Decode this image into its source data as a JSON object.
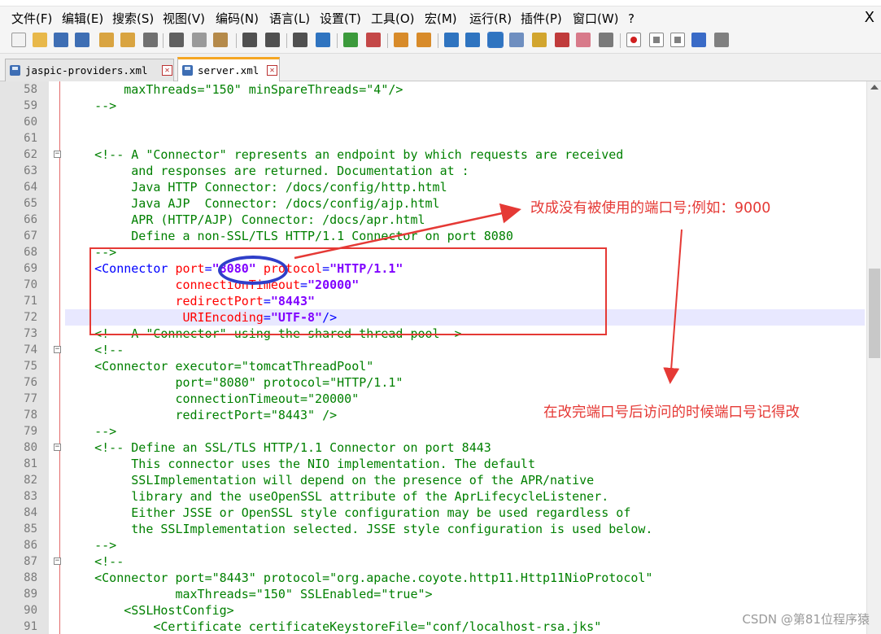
{
  "menu": {
    "items": [
      "文件(F)",
      "编辑(E)",
      "搜索(S)",
      "视图(V)",
      "编码(N)",
      "语言(L)",
      "设置(T)",
      "工具(O)",
      "宏(M)",
      "运行(R)",
      "插件(P)",
      "窗口(W)",
      "?"
    ],
    "close_label": "X"
  },
  "toolbar": {
    "buttons": [
      {
        "icon": "new-file-icon",
        "color": "#f2f2f2"
      },
      {
        "icon": "open-file-icon",
        "color": "#e8b84a"
      },
      {
        "icon": "save-icon",
        "color": "#3e6eb4"
      },
      {
        "icon": "save-all-icon",
        "color": "#3e6eb4"
      },
      {
        "icon": "close-icon",
        "color": "#d9a441"
      },
      {
        "icon": "close-all-icon",
        "color": "#d9a441"
      },
      {
        "icon": "print-icon",
        "color": "#707070"
      },
      {
        "icon": "cut-icon",
        "color": "#606060"
      },
      {
        "icon": "copy-icon",
        "color": "#9a9a9a"
      },
      {
        "icon": "paste-icon",
        "color": "#b58a4a"
      },
      {
        "icon": "undo-icon",
        "color": "#505050"
      },
      {
        "icon": "redo-icon",
        "color": "#505050"
      },
      {
        "icon": "find-icon",
        "color": "#505050"
      },
      {
        "icon": "replace-icon",
        "color": "#2f74c0"
      },
      {
        "icon": "zoom-in-icon",
        "color": "#3c9a3c"
      },
      {
        "icon": "zoom-out-icon",
        "color": "#c44848"
      },
      {
        "icon": "sync-vertical-icon",
        "color": "#d88b2a"
      },
      {
        "icon": "sync-horizontal-icon",
        "color": "#d88b2a"
      },
      {
        "icon": "word-wrap-icon",
        "color": "#2f74c0"
      },
      {
        "icon": "show-all-chars-icon",
        "color": "#2f74c0"
      },
      {
        "icon": "indent-guide-icon",
        "color": "#2f74c0"
      },
      {
        "icon": "user-language-icon",
        "color": "#6f8fc0"
      },
      {
        "icon": "document-map-icon",
        "color": "#d2a52e"
      },
      {
        "icon": "function-list-icon",
        "color": "#c03b3b"
      },
      {
        "icon": "folder-workspace-icon",
        "color": "#d87a8a"
      },
      {
        "icon": "monitoring-icon",
        "color": "#7a7a7a"
      },
      {
        "icon": "record-macro-icon",
        "color": "#d02020"
      },
      {
        "icon": "stop-macro-icon",
        "color": "#808080"
      },
      {
        "icon": "play-macro-icon",
        "color": "#808080"
      },
      {
        "icon": "run-macro-multiple-icon",
        "color": "#3a6bc7"
      },
      {
        "icon": "save-macro-icon",
        "color": "#808080"
      }
    ]
  },
  "tabs": [
    {
      "label": "jaspic-providers.xml",
      "active": false
    },
    {
      "label": "server.xml",
      "active": true
    }
  ],
  "editor": {
    "current_line": 72,
    "lines": [
      {
        "n": 58,
        "fold": false,
        "segs": [
          [
            "c",
            "        maxThreads=\"150\" minSpareThreads=\"4\"/>"
          ]
        ]
      },
      {
        "n": 59,
        "fold": false,
        "segs": [
          [
            "c",
            "    -->"
          ]
        ]
      },
      {
        "n": 60,
        "fold": false,
        "segs": []
      },
      {
        "n": 61,
        "fold": false,
        "segs": []
      },
      {
        "n": 62,
        "fold": true,
        "segs": [
          [
            "c",
            "    <!-- A \"Connector\" represents an endpoint by which requests are received"
          ]
        ]
      },
      {
        "n": 63,
        "fold": false,
        "segs": [
          [
            "c",
            "         and responses are returned. Documentation at :"
          ]
        ]
      },
      {
        "n": 64,
        "fold": false,
        "segs": [
          [
            "c",
            "         Java HTTP Connector: /docs/config/http.html"
          ]
        ]
      },
      {
        "n": 65,
        "fold": false,
        "segs": [
          [
            "c",
            "         Java AJP  Connector: /docs/config/ajp.html"
          ]
        ]
      },
      {
        "n": 66,
        "fold": false,
        "segs": [
          [
            "c",
            "         APR (HTTP/AJP) Connector: /docs/apr.html"
          ]
        ]
      },
      {
        "n": 67,
        "fold": false,
        "segs": [
          [
            "c",
            "         Define a non-SSL/TLS HTTP/1.1 Connector on port 8080"
          ]
        ]
      },
      {
        "n": 68,
        "fold": false,
        "segs": [
          [
            "c",
            "    -->"
          ]
        ]
      },
      {
        "n": 69,
        "fold": false,
        "segs": [
          [
            "t",
            "    <Connector "
          ],
          [
            "a",
            "port"
          ],
          [
            "p",
            "="
          ],
          [
            "v",
            "\"8080\""
          ],
          [
            "a",
            " protocol"
          ],
          [
            "p",
            "="
          ],
          [
            "v",
            "\"HTTP/1.1\""
          ]
        ]
      },
      {
        "n": 70,
        "fold": false,
        "segs": [
          [
            "a",
            "               connectionTimeout"
          ],
          [
            "p",
            "="
          ],
          [
            "v",
            "\"20000\""
          ]
        ]
      },
      {
        "n": 71,
        "fold": false,
        "segs": [
          [
            "a",
            "               redirectPort"
          ],
          [
            "p",
            "="
          ],
          [
            "v",
            "\"8443\""
          ]
        ]
      },
      {
        "n": 72,
        "fold": false,
        "segs": [
          [
            "a",
            "                URIEncoding"
          ],
          [
            "p",
            "="
          ],
          [
            "v",
            "\"UTF-8\""
          ],
          [
            "t",
            "/>"
          ]
        ]
      },
      {
        "n": 73,
        "fold": false,
        "segs": [
          [
            "c",
            "    <!-- A \"Connector\" using the shared thread pool-->"
          ]
        ]
      },
      {
        "n": 74,
        "fold": true,
        "segs": [
          [
            "c",
            "    <!--"
          ]
        ]
      },
      {
        "n": 75,
        "fold": false,
        "segs": [
          [
            "c",
            "    <Connector executor=\"tomcatThreadPool\""
          ]
        ]
      },
      {
        "n": 76,
        "fold": false,
        "segs": [
          [
            "c",
            "               port=\"8080\" protocol=\"HTTP/1.1\""
          ]
        ]
      },
      {
        "n": 77,
        "fold": false,
        "segs": [
          [
            "c",
            "               connectionTimeout=\"20000\""
          ]
        ]
      },
      {
        "n": 78,
        "fold": false,
        "segs": [
          [
            "c",
            "               redirectPort=\"8443\" />"
          ]
        ]
      },
      {
        "n": 79,
        "fold": false,
        "segs": [
          [
            "c",
            "    -->"
          ]
        ]
      },
      {
        "n": 80,
        "fold": true,
        "segs": [
          [
            "c",
            "    <!-- Define an SSL/TLS HTTP/1.1 Connector on port 8443"
          ]
        ]
      },
      {
        "n": 81,
        "fold": false,
        "segs": [
          [
            "c",
            "         This connector uses the NIO implementation. The default"
          ]
        ]
      },
      {
        "n": 82,
        "fold": false,
        "segs": [
          [
            "c",
            "         SSLImplementation will depend on the presence of the APR/native"
          ]
        ]
      },
      {
        "n": 83,
        "fold": false,
        "segs": [
          [
            "c",
            "         library and the useOpenSSL attribute of the AprLifecycleListener."
          ]
        ]
      },
      {
        "n": 84,
        "fold": false,
        "segs": [
          [
            "c",
            "         Either JSSE or OpenSSL style configuration may be used regardless of"
          ]
        ]
      },
      {
        "n": 85,
        "fold": false,
        "segs": [
          [
            "c",
            "         the SSLImplementation selected. JSSE style configuration is used below."
          ]
        ]
      },
      {
        "n": 86,
        "fold": false,
        "segs": [
          [
            "c",
            "    -->"
          ]
        ]
      },
      {
        "n": 87,
        "fold": true,
        "segs": [
          [
            "c",
            "    <!--"
          ]
        ]
      },
      {
        "n": 88,
        "fold": false,
        "segs": [
          [
            "c",
            "    <Connector port=\"8443\" protocol=\"org.apache.coyote.http11.Http11NioProtocol\""
          ]
        ]
      },
      {
        "n": 89,
        "fold": false,
        "segs": [
          [
            "c",
            "               maxThreads=\"150\" SSLEnabled=\"true\">"
          ]
        ]
      },
      {
        "n": 90,
        "fold": false,
        "segs": [
          [
            "c",
            "        <SSLHostConfig>"
          ]
        ]
      },
      {
        "n": 91,
        "fold": false,
        "segs": [
          [
            "c",
            "            <Certificate certificateKeystoreFile=\"conf/localhost-rsa.jks\""
          ]
        ]
      }
    ]
  },
  "annotations": {
    "note1": "改成没有被使用的端口号;例如：9000",
    "note2": "在改完端口号后访问的时候端口号记得改",
    "color": "#e53935",
    "ellipse_color": "#2f3fc9"
  },
  "watermark": "CSDN @第81位程序猿"
}
